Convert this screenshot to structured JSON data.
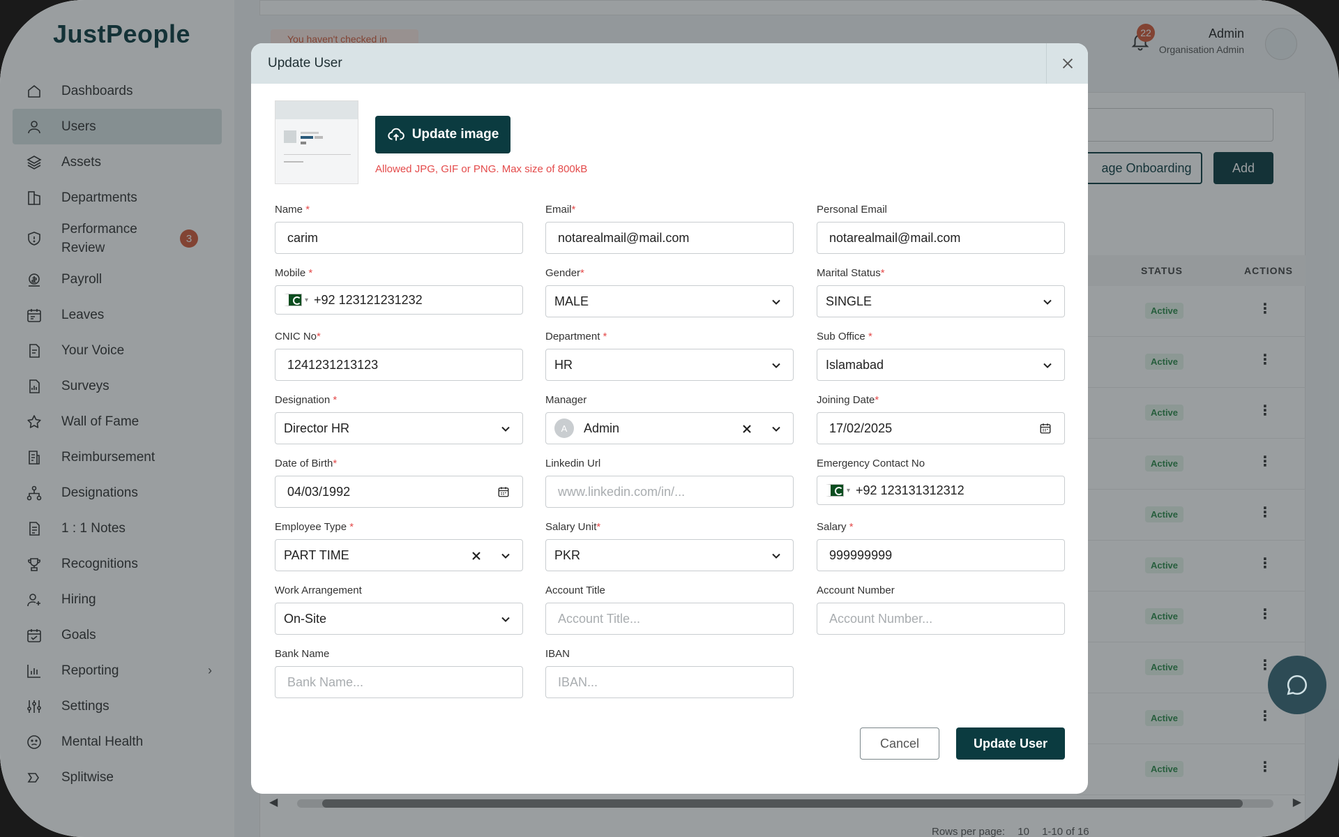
{
  "app": {
    "logo": "JustPeople"
  },
  "sidebar": {
    "items": [
      {
        "label": "Dashboards",
        "icon": "home-icon"
      },
      {
        "label": "Users",
        "icon": "user-icon",
        "active": true
      },
      {
        "label": "Assets",
        "icon": "layers-icon"
      },
      {
        "label": "Departments",
        "icon": "departments-icon"
      },
      {
        "label": "Performance Review",
        "icon": "shield-icon",
        "badge": "3"
      },
      {
        "label": "Payroll",
        "icon": "payroll-icon"
      },
      {
        "label": "Leaves",
        "icon": "calendar-icon"
      },
      {
        "label": "Your Voice",
        "icon": "document-icon"
      },
      {
        "label": "Surveys",
        "icon": "survey-icon"
      },
      {
        "label": "Wall of Fame",
        "icon": "star-icon"
      },
      {
        "label": "Reimbursement",
        "icon": "receipt-icon"
      },
      {
        "label": "Designations",
        "icon": "hierarchy-icon"
      },
      {
        "label": "1 : 1 Notes",
        "icon": "note-icon"
      },
      {
        "label": "Recognitions",
        "icon": "trophy-icon"
      },
      {
        "label": "Hiring",
        "icon": "user-add-icon"
      },
      {
        "label": "Goals",
        "icon": "goals-icon"
      },
      {
        "label": "Reporting",
        "icon": "chart-icon",
        "chevron": true
      },
      {
        "label": "Settings",
        "icon": "sliders-icon"
      },
      {
        "label": "Mental Health",
        "icon": "face-icon"
      },
      {
        "label": "Splitwise",
        "icon": "split-icon"
      }
    ]
  },
  "background": {
    "checkin_notice": "You haven't checked in",
    "notifications_count": "22",
    "user_name": "Admin",
    "user_role": "Organisation Admin",
    "onboarding_button": "age Onboarding",
    "add_button": "Add",
    "table": {
      "headers": [
        "STATUS",
        "ACTIONS"
      ],
      "rows": [
        "Active",
        "Active",
        "Active",
        "Active",
        "Active",
        "Active",
        "Active",
        "Active",
        "Active",
        "Active"
      ]
    },
    "pager": {
      "rows_per_page_label": "Rows per page:",
      "rows_per_page": "10",
      "range": "1-10 of 16"
    }
  },
  "modal": {
    "title": "Update User",
    "upload_button": "Update image",
    "upload_hint": "Allowed JPG, GIF or PNG. Max size of 800kB",
    "fields": {
      "name": {
        "label": "Name",
        "required": "*",
        "value": "carim"
      },
      "email": {
        "label": "Email",
        "required": "*",
        "value": "notarealmail@mail.com"
      },
      "personal_email": {
        "label": "Personal Email",
        "value": "notarealmail@mail.com"
      },
      "mobile": {
        "label": "Mobile",
        "required": "*",
        "value": "+92 123121231232"
      },
      "gender": {
        "label": "Gender",
        "required": "*",
        "value": "MALE"
      },
      "marital_status": {
        "label": "Marital Status",
        "required": "*",
        "value": "SINGLE"
      },
      "cnic": {
        "label": "CNIC No",
        "required": "*",
        "value": "1241231213123"
      },
      "department": {
        "label": "Department",
        "required": "*",
        "value": "HR"
      },
      "sub_office": {
        "label": "Sub Office",
        "required": "*",
        "value": "Islamabad"
      },
      "designation": {
        "label": "Designation",
        "required": "*",
        "value": "Director HR"
      },
      "manager": {
        "label": "Manager",
        "value": "Admin",
        "avatar_letter": "A"
      },
      "joining_date": {
        "label": "Joining Date",
        "required": "*",
        "value": "17/02/2025"
      },
      "dob": {
        "label": "Date of Birth",
        "required": "*",
        "value": "04/03/1992"
      },
      "linkedin": {
        "label": "Linkedin Url",
        "placeholder": "www.linkedin.com/in/..."
      },
      "emergency": {
        "label": "Emergency Contact No",
        "value": "+92 123131312312"
      },
      "employee_type": {
        "label": "Employee Type",
        "required": "*",
        "value": "PART TIME"
      },
      "salary_unit": {
        "label": "Salary Unit",
        "required": "*",
        "value": "PKR"
      },
      "salary": {
        "label": "Salary",
        "required": "*",
        "value": "999999999"
      },
      "work_arrangement": {
        "label": "Work Arrangement",
        "value": "On-Site"
      },
      "account_title": {
        "label": "Account Title",
        "placeholder": "Account Title..."
      },
      "account_number": {
        "label": "Account Number",
        "placeholder": "Account Number..."
      },
      "bank_name": {
        "label": "Bank Name",
        "placeholder": "Bank Name..."
      },
      "iban": {
        "label": "IBAN",
        "placeholder": "IBAN..."
      }
    },
    "cancel_button": "Cancel",
    "submit_button": "Update User"
  },
  "colors": {
    "brand": "#0b3b40",
    "badge": "#d35a3a",
    "required": "#e44b4b",
    "status_active": "#2f8a4b"
  }
}
